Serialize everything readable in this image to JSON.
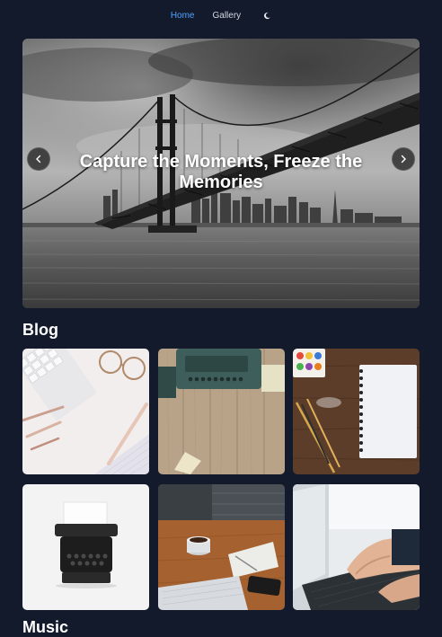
{
  "nav": {
    "items": [
      {
        "label": "Home",
        "active": true
      },
      {
        "label": "Gallery",
        "active": false
      }
    ],
    "theme_toggle_icon": "moon-icon",
    "active_color": "#4fa3ff"
  },
  "hero": {
    "caption": "Capture the Moments, Freeze the Memories",
    "prev_icon": "chevron-left-icon",
    "next_icon": "chevron-right-icon"
  },
  "blog": {
    "title": "Blog",
    "posts": [
      {
        "image": "keyboard-glasses-pens"
      },
      {
        "image": "typewriter-on-wood"
      },
      {
        "image": "notebook-paints-pencils"
      },
      {
        "image": "vintage-typewriter"
      },
      {
        "image": "laptop-coffee-desk"
      },
      {
        "image": "hands-typing-laptop"
      }
    ]
  },
  "music": {
    "title": "Music"
  },
  "colors": {
    "background": "#121a2c",
    "text": "#ffffff",
    "nav_text": "#d3d7df"
  }
}
